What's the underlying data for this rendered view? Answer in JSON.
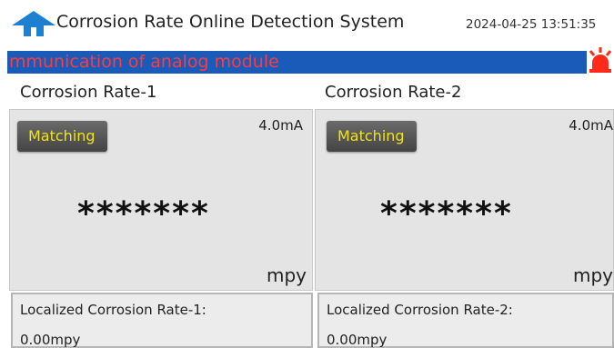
{
  "header": {
    "title": "Corrosion Rate Online Detection System",
    "datetime": "2024-04-25 13:51:35"
  },
  "alarm": {
    "message": "mmunication of analog module"
  },
  "panels": [
    {
      "label": "Corrosion Rate-1",
      "status_button": "Matching",
      "current": "4.0mA",
      "value": "*******",
      "unit": "mpy",
      "local_label": "Localized Corrosion Rate-1:",
      "local_value": "0.00mpy"
    },
    {
      "label": "Corrosion Rate-2",
      "status_button": "Matching",
      "current": "4.0mA",
      "value": "*******",
      "unit": "mpy",
      "local_label": "Localized Corrosion Rate-2:",
      "local_value": "0.00mpy"
    }
  ],
  "colors": {
    "alarm_bar": "#1a5ab8",
    "alarm_text": "#ff3b3b",
    "button_text": "#f0e31f",
    "home_icon": "#1f7fd1"
  }
}
